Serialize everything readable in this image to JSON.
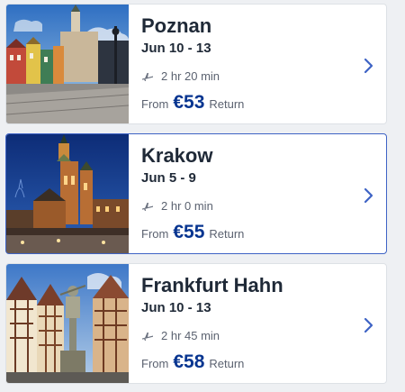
{
  "flights": [
    {
      "city": "Poznan",
      "dates": "Jun 10 - 13",
      "duration": "2 hr 20 min",
      "from_label": "From",
      "price": "€53",
      "trip_type": "Return",
      "selected": false
    },
    {
      "city": "Krakow",
      "dates": "Jun 5 - 9",
      "duration": "2 hr 0 min",
      "from_label": "From",
      "price": "€55",
      "trip_type": "Return",
      "selected": true
    },
    {
      "city": "Frankfurt Hahn",
      "dates": "Jun 10 - 13",
      "duration": "2 hr 45 min",
      "from_label": "From",
      "price": "€58",
      "trip_type": "Return",
      "selected": false
    }
  ],
  "icons": {
    "duration": "plane-icon",
    "open_details": "chevron-right-icon"
  },
  "colors": {
    "price": "#073590",
    "chevron": "#3e63c5",
    "selected_border": "#3e63c5"
  }
}
